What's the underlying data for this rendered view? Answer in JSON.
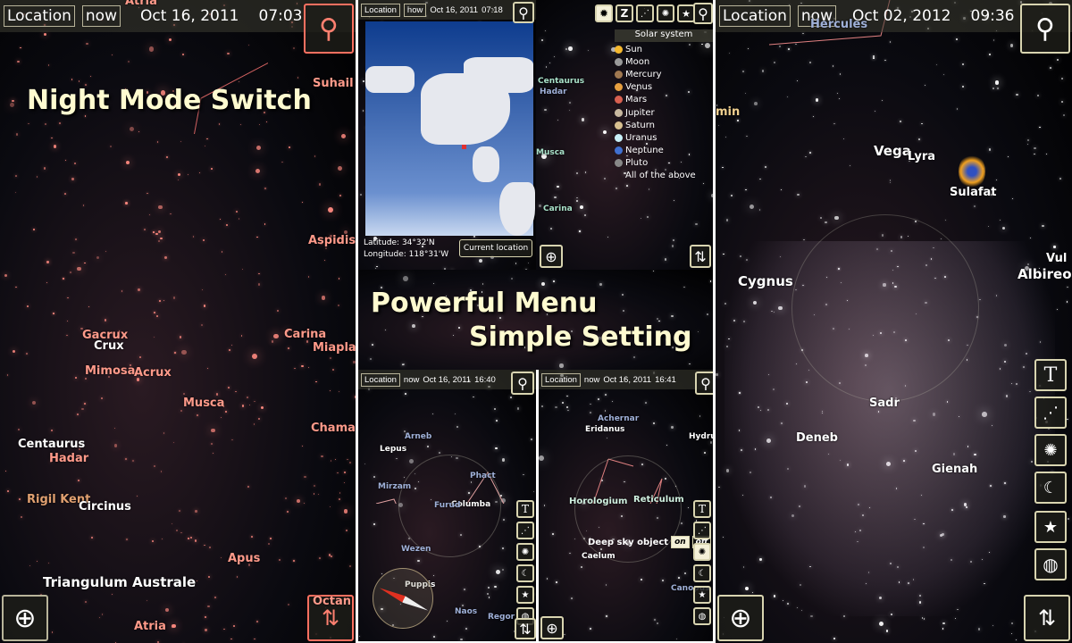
{
  "left": {
    "location": "Location",
    "now": "now",
    "date": "Oct 16, 2011",
    "time": "07:03",
    "promo": "Night Mode Switch",
    "labels": [
      "Atria",
      "Suhail",
      "Aspidis",
      "Carina",
      "Miapla",
      "Crux",
      "Gacrux",
      "Mimosa",
      "Acrux",
      "Musca",
      "Chama",
      "Centaurus",
      "Hadar",
      "Rigil Kent",
      "Circinus",
      "Apus",
      "Triangulum Australe",
      "Atria",
      "Octan"
    ]
  },
  "middle": {
    "promo_line1": "Powerful Menu",
    "promo_line2": "Simple Setting",
    "map_panel": {
      "location": "Location",
      "now": "now",
      "date": "Oct 16, 2011",
      "time": "07:18",
      "latitude_label": "Latitude:",
      "latitude": "34°32'N",
      "longitude_label": "Longitude:",
      "longitude": "118°31'W",
      "current_location": "Current location"
    },
    "solar_panel": {
      "title": "Solar system",
      "toolbar": [
        "sun-icon",
        "Z",
        "constellation-icon",
        "deep-sky-icon",
        "star-icon"
      ],
      "items": [
        {
          "name": "Sun",
          "color": "#f5b82e"
        },
        {
          "name": "Moon",
          "color": "#999999"
        },
        {
          "name": "Mercury",
          "color": "#a07850"
        },
        {
          "name": "Venus",
          "color": "#e8a040"
        },
        {
          "name": "Mars",
          "color": "#d86050"
        },
        {
          "name": "Jupiter",
          "color": "#c8b8a0"
        },
        {
          "name": "Saturn",
          "color": "#d8c090"
        },
        {
          "name": "Uranus",
          "color": "#c8f0f8"
        },
        {
          "name": "Neptune",
          "color": "#4070d0"
        },
        {
          "name": "Pluto",
          "color": "#888888"
        }
      ],
      "all": "All of the above",
      "labels": [
        "Centaurus",
        "Hadar",
        "Musca",
        "Carina"
      ]
    },
    "bottom_left": {
      "location": "Location",
      "now": "now",
      "date": "Oct 16, 2011",
      "time": "16:40",
      "labels": [
        "Lepus",
        "Arneb",
        "Mirzam",
        "Phact",
        "Columba",
        "Furud",
        "Wezen",
        "Puppis",
        "Naos",
        "Regor"
      ]
    },
    "bottom_right": {
      "location": "Location",
      "now": "now",
      "date": "Oct 16, 2011",
      "time": "16:41",
      "labels": [
        "Achernar",
        "Eridanus",
        "Hydrus",
        "Horologium",
        "Reticulum",
        "Caelum",
        "Canopus"
      ],
      "toggle_label": "Deep sky object",
      "on": "on",
      "off": "off"
    }
  },
  "right": {
    "location": "Location",
    "now": "now",
    "date": "Oct 02, 2012",
    "time": "09:36",
    "labels": [
      "Hercules",
      "Vega",
      "Lyra",
      "Sulafat",
      "Cygnus",
      "Albireo",
      "Sadr",
      "Deneb",
      "Gienah",
      "Vul",
      "min"
    ],
    "tools": [
      "T",
      "constellation-icon",
      "galaxy-icon",
      "moon-icon",
      "star-icon",
      "globe-icon"
    ]
  }
}
